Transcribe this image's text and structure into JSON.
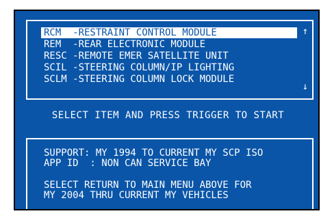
{
  "colors": {
    "background": "#0a55a8",
    "foreground": "#ffffff",
    "selected_text": "#0a55a8"
  },
  "module_list": {
    "items": [
      {
        "label": "RCM  -RESTRAINT CONTROL MODULE",
        "selected": true
      },
      {
        "label": "REM  -REAR ELECTRONIC MODULE",
        "selected": false
      },
      {
        "label": "RESC -REMOTE EMER SATELLITE UNIT",
        "selected": false
      },
      {
        "label": "SCIL -STEERING COLUMN/IP LIGHTING",
        "selected": false
      },
      {
        "label": "SCLM -STEERING COLUMN LOCK MODULE",
        "selected": false
      }
    ],
    "scroll_up_icon": "up-arrow-icon",
    "scroll_down_icon": "down-arrow-icon",
    "scroll_up_glyph": "↑",
    "scroll_down_glyph": "↓"
  },
  "prompt": "SELECT ITEM AND PRESS TRIGGER TO START",
  "info": {
    "support": "SUPPORT: MY 1994 TO CURRENT MY SCP ISO",
    "app_id": "APP ID  : NON CAN SERVICE BAY",
    "note_line1": "SELECT RETURN TO MAIN MENU ABOVE FOR",
    "note_line2": "MY 2004 THRU CURRENT MY VEHICLES"
  }
}
